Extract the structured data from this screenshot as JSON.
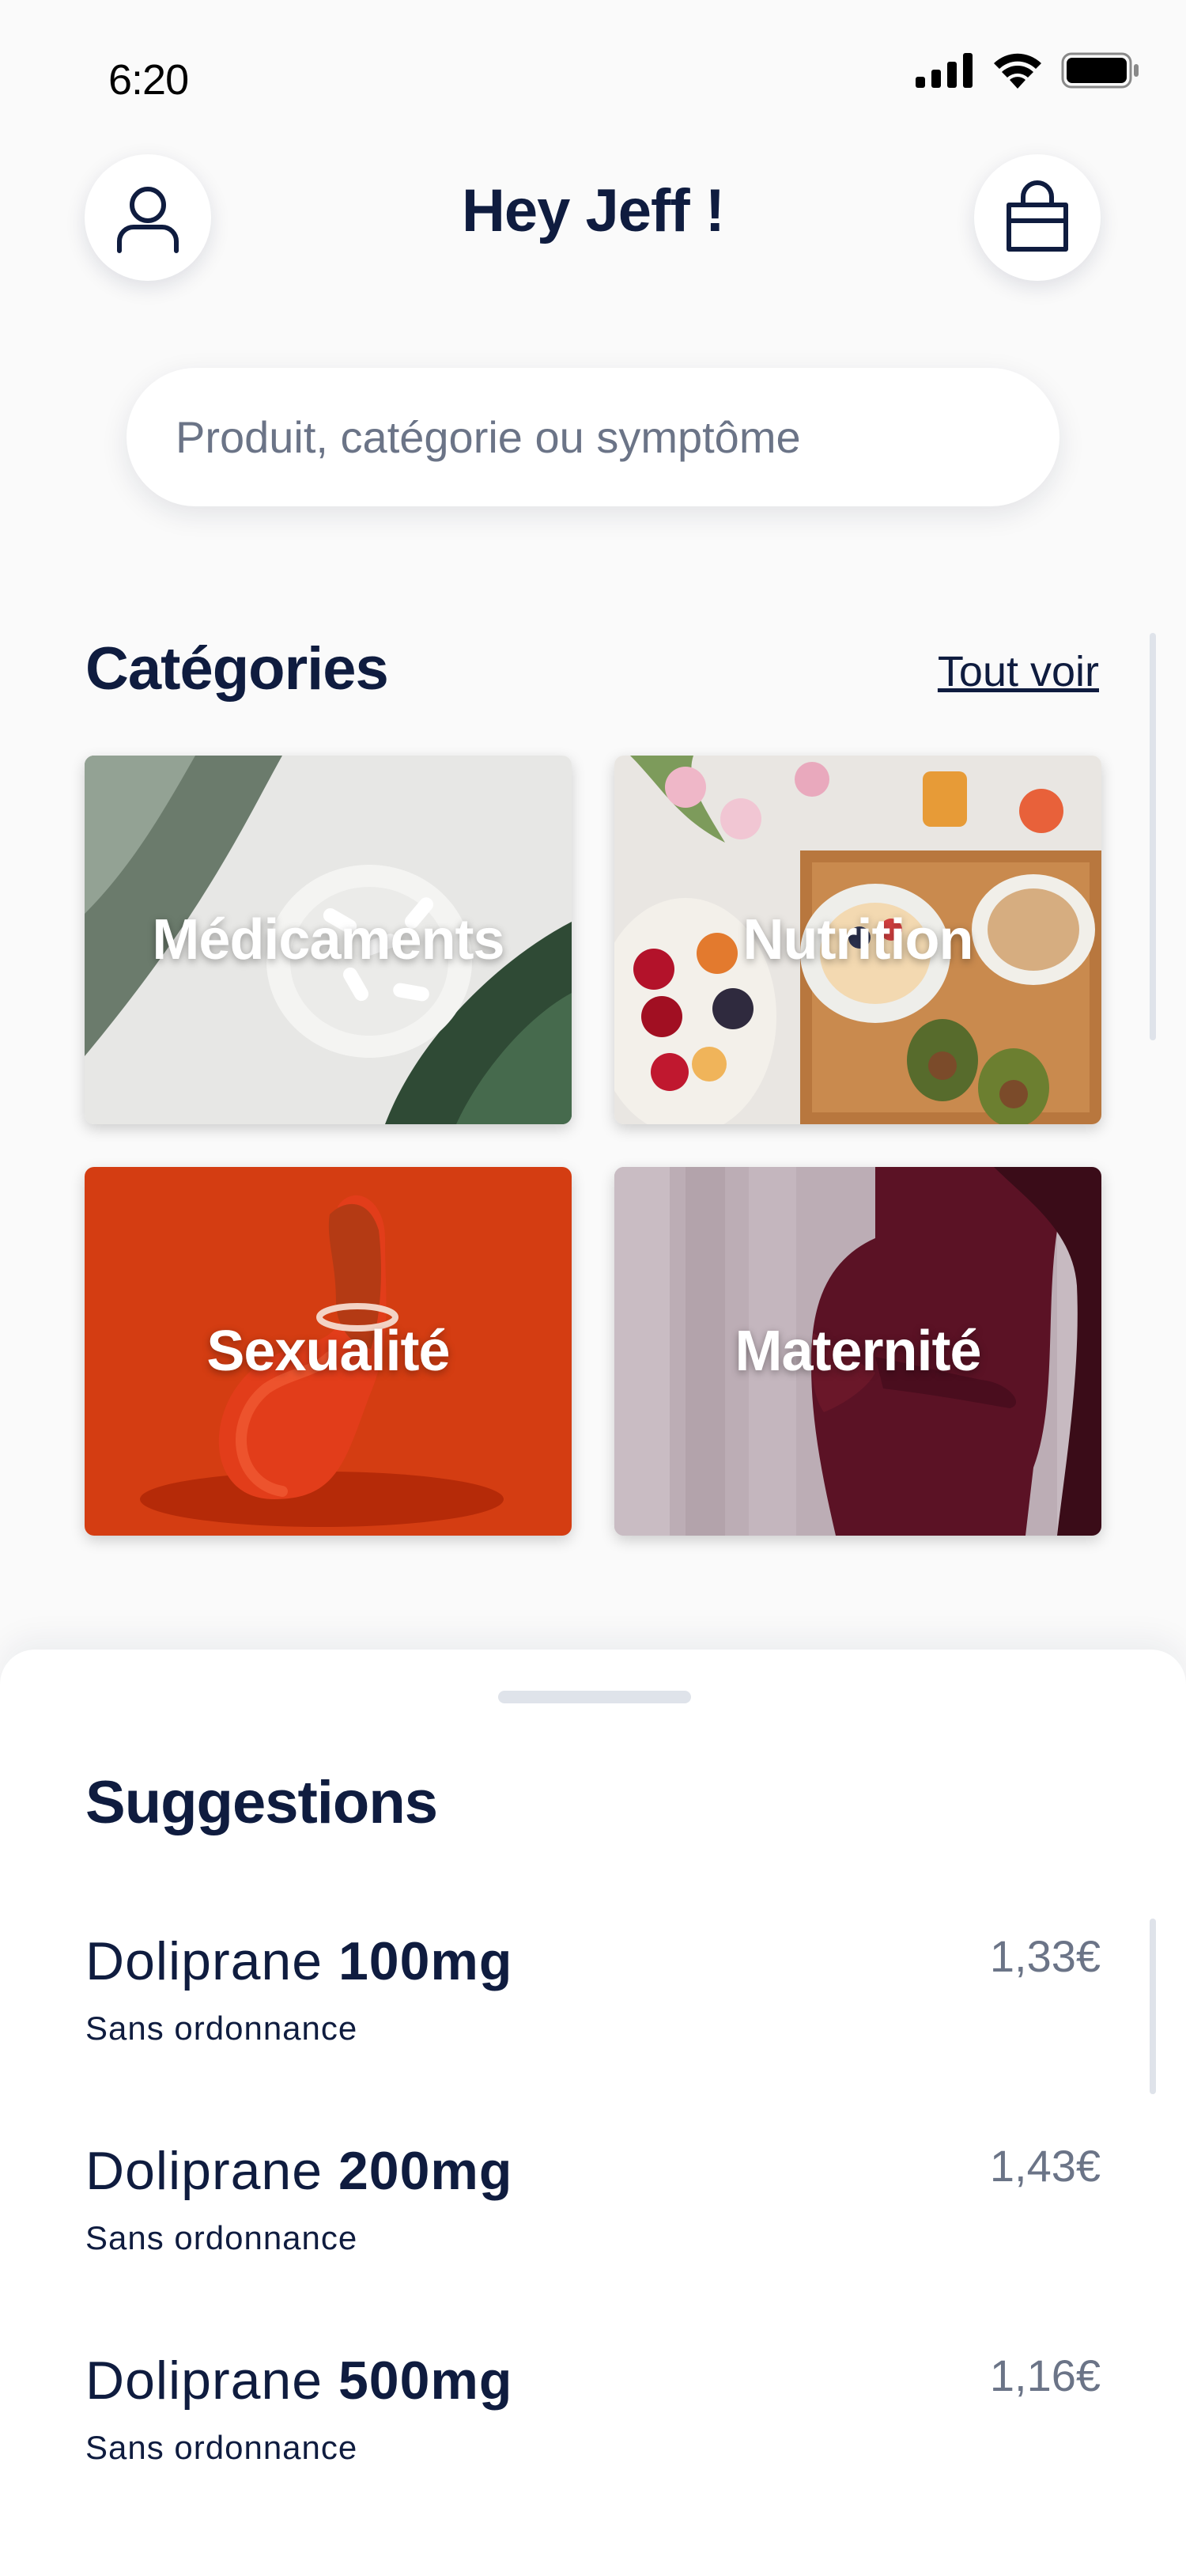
{
  "status": {
    "time": "6:20"
  },
  "header": {
    "greeting": "Hey Jeff !"
  },
  "search": {
    "placeholder": "Produit, catégorie ou symptôme"
  },
  "categories": {
    "title": "Catégories",
    "see_all": "Tout voir",
    "items": [
      {
        "label": "Médicaments",
        "image": "pills-on-plate-with-leaves"
      },
      {
        "label": "Nutrition",
        "image": "fruit-and-breakfast-bowls"
      },
      {
        "label": "Sexualité",
        "image": "fruit-with-condom-on-red"
      },
      {
        "label": "Maternité",
        "image": "pregnant-woman-silhouette"
      }
    ]
  },
  "suggestions": {
    "title": "Suggestions",
    "items": [
      {
        "name": "Doliprane",
        "dose": "100mg",
        "subtitle": "Sans ordonnance",
        "price": "1,33€"
      },
      {
        "name": "Doliprane",
        "dose": "200mg",
        "subtitle": "Sans ordonnance",
        "price": "1,43€"
      },
      {
        "name": "Doliprane",
        "dose": "500mg",
        "subtitle": "Sans ordonnance",
        "price": "1,16€"
      }
    ]
  },
  "colors": {
    "navy": "#0f1c3f",
    "muted": "#6b7487",
    "background": "#fafafa"
  }
}
